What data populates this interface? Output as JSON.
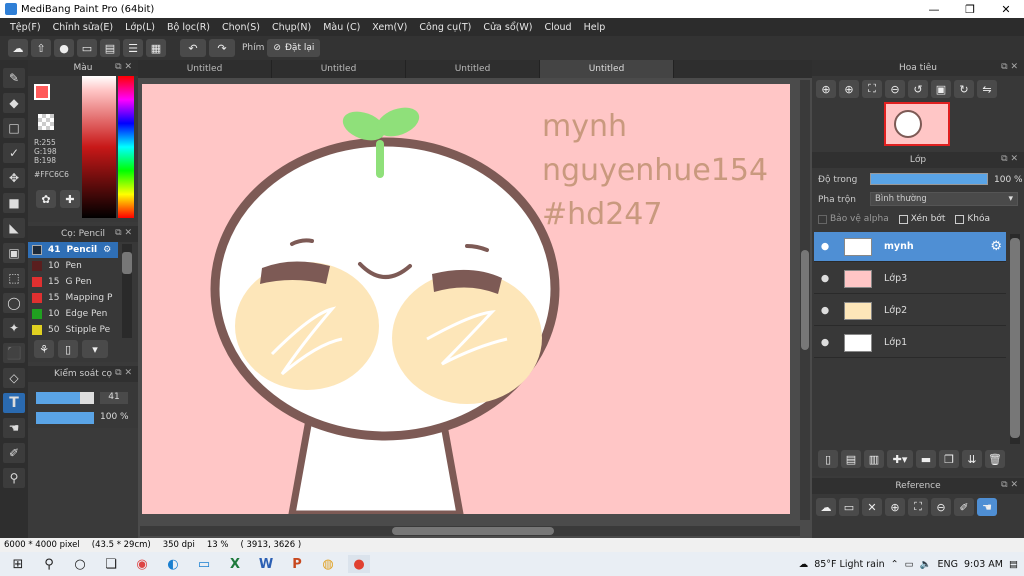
{
  "window": {
    "title": "MediBang Paint Pro (64bit)",
    "min": "—",
    "max": "❐",
    "close": "✕"
  },
  "menu": [
    "Tệp(F)",
    "Chỉnh sửa(E)",
    "Lớp(L)",
    "Bộ lọc(R)",
    "Chọn(S)",
    "Chụp(N)",
    "Màu (C)",
    "Xem(V)",
    "Công cụ(T)",
    "Cửa sổ(W)",
    "Cloud",
    "Help"
  ],
  "toolbar": {
    "keys_label": "Phím",
    "reset_label": "Đặt lại"
  },
  "tabs": [
    "Untitled",
    "Untitled",
    "Untitled",
    "Untitled"
  ],
  "color_panel": {
    "title": "Màu",
    "rgb": {
      "r": "R:255",
      "g": "G:198",
      "b": "B:198"
    },
    "hex": "#FFC6C6",
    "primary_color": "#ff5a5a"
  },
  "brush_panel": {
    "title": "Cọ: Pencil",
    "items": [
      {
        "size": "41",
        "name": "Pencil",
        "color": "#1e2a38"
      },
      {
        "size": "10",
        "name": "Pen",
        "color": "#5a1e1e"
      },
      {
        "size": "15",
        "name": "G Pen",
        "color": "#e03030"
      },
      {
        "size": "15",
        "name": "Mapping P",
        "color": "#e03030"
      },
      {
        "size": "10",
        "name": "Edge Pen",
        "color": "#20a020"
      },
      {
        "size": "50",
        "name": "Stipple Pe",
        "color": "#e0d020"
      }
    ]
  },
  "control_panel": {
    "title": "Kiểm soát cọ",
    "size_value": "41",
    "opacity_value": "100 %",
    "size_fraction": 0.75,
    "opacity_fraction": 1.0
  },
  "canvas": {
    "background": "#ffc6c6",
    "text_lines": [
      "mynh",
      "nguyenhue154",
      "#hd247"
    ],
    "text_color": "#c9997e"
  },
  "nav_panel": {
    "title": "Hoa tiêu"
  },
  "layer_panel": {
    "title": "Lớp",
    "opacity_label": "Độ trong",
    "opacity_value": "100 %",
    "blend_label": "Pha trộn",
    "blend_value": "Bình thường",
    "protect_alpha": "Bảo vệ alpha",
    "clip": "Xén bớt",
    "lock": "Khóa",
    "layers": [
      "mynh",
      "Lớp3",
      "Lớp2",
      "Lớp1"
    ]
  },
  "ref_panel": {
    "title": "Reference"
  },
  "status": {
    "size": "6000 * 4000 pixel",
    "cm": "(43.5 * 29cm)",
    "dpi": "350 dpi",
    "zoom": "13 %",
    "coords": "( 3913, 3626 )"
  },
  "taskbar": {
    "weather": "85°F  Light rain",
    "lang": "ENG",
    "time": "9:03 AM"
  }
}
